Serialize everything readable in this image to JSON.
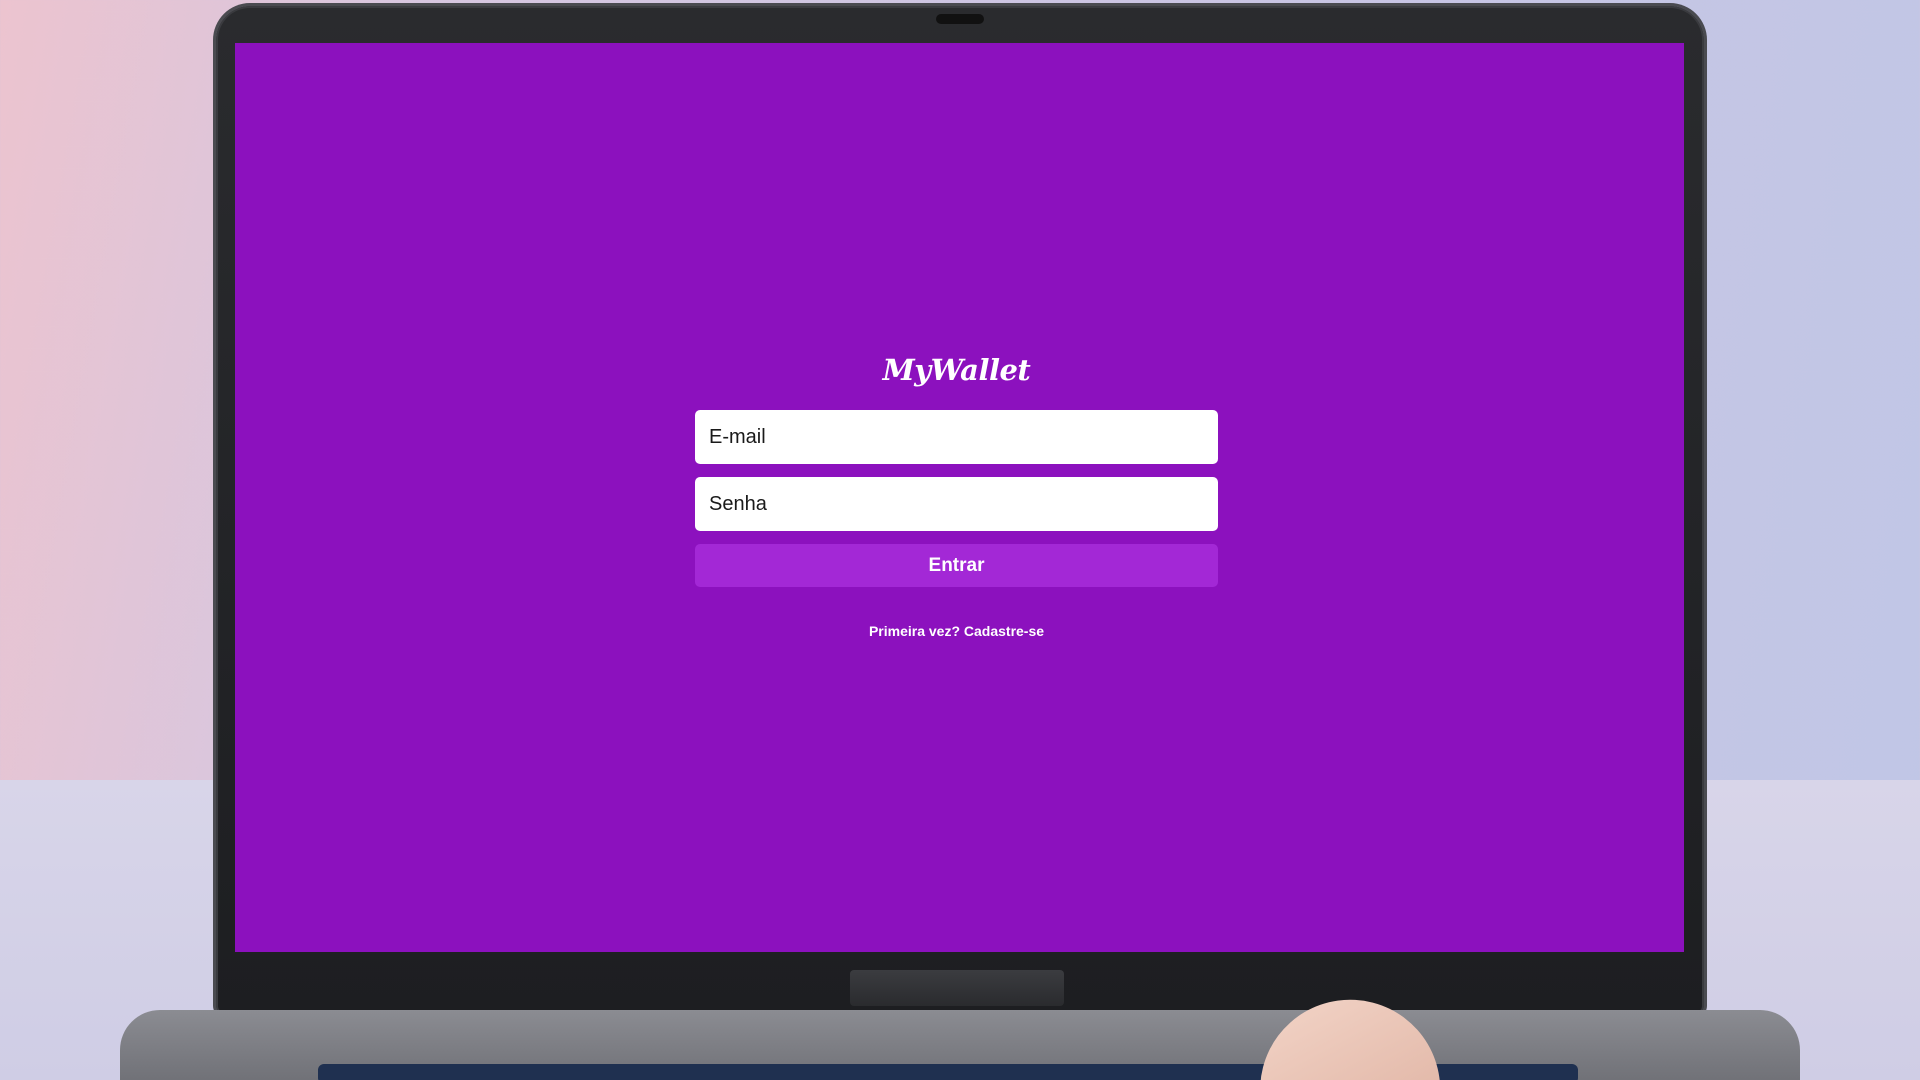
{
  "app": {
    "logo_text": "MyWallet"
  },
  "login_form": {
    "email_placeholder": "E-mail",
    "password_placeholder": "Senha",
    "submit_label": "Entrar",
    "signup_link_label": "Primeira vez? Cadastre-se"
  },
  "colors": {
    "screen_background": "#8c11be",
    "button_background": "#a328d6",
    "input_background": "#ffffff",
    "text": "#ffffff"
  }
}
